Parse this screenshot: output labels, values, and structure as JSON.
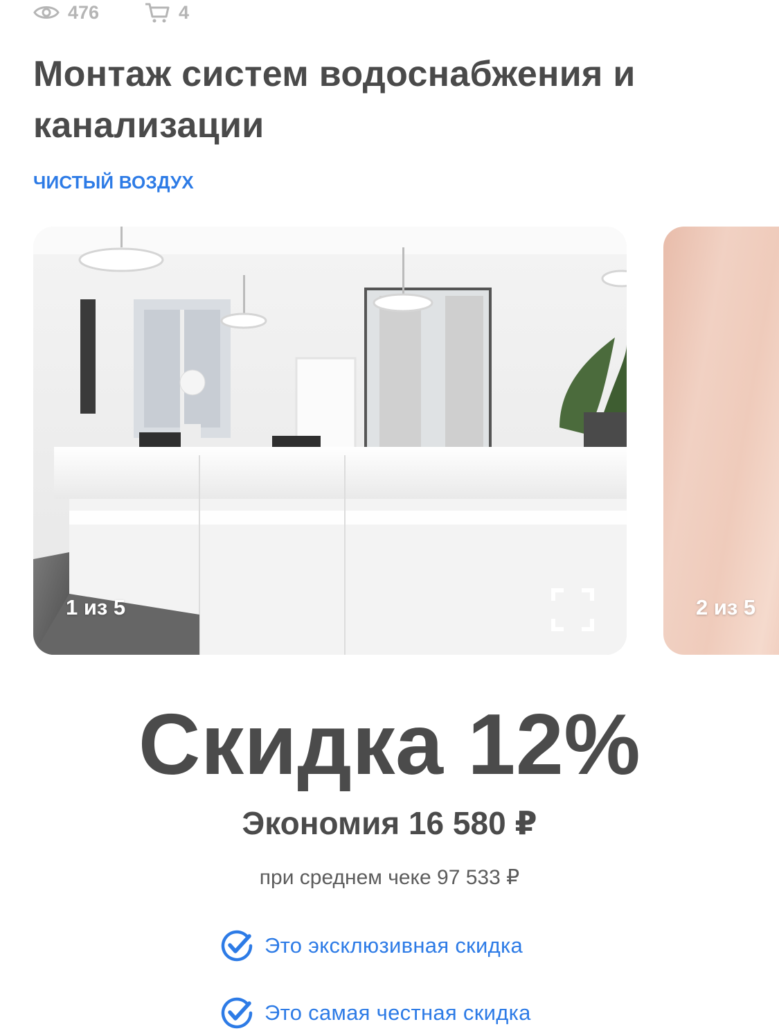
{
  "stats": {
    "views": "476",
    "cart": "4",
    "views_icon": "eye-icon",
    "cart_icon": "cart-icon"
  },
  "offer": {
    "title": "Монтаж систем водоснабжения и канализации",
    "company": "ЧИСТЫЙ ВОЗДУХ"
  },
  "gallery": {
    "slides": [
      {
        "counter": "1 из 5"
      },
      {
        "counter": "2 из 5"
      }
    ],
    "fullscreen_icon": "fullscreen-icon"
  },
  "discount": {
    "title": "Скидка 12%",
    "savings": "Экономия 16 580 ₽",
    "avg_check": "при среднем чеке 97 533 ₽"
  },
  "benefits": [
    {
      "label": "Это эксклюзивная скидка",
      "icon": "checkmark-badge-icon"
    },
    {
      "label": "Это самая честная скидка",
      "icon": "checkmark-badge-icon"
    }
  ],
  "colors": {
    "accent": "#2d7be6",
    "text": "#4a4a4a",
    "muted": "#b5b5b5"
  }
}
